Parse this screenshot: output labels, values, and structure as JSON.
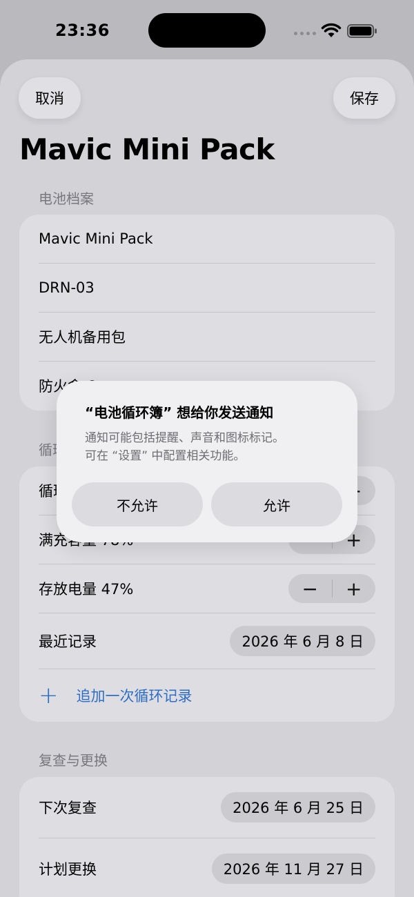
{
  "status_bar": {
    "time": "23:36"
  },
  "nav": {
    "cancel_label": "取消",
    "save_label": "保存",
    "title": "Mavic Mini Pack"
  },
  "profile_section": {
    "header": "电池档案",
    "rows": [
      "Mavic Mini Pack",
      "DRN-03",
      "无人机备用包",
      "防火盒 6"
    ]
  },
  "cycle_section": {
    "header": "循环",
    "rows": {
      "cycles_label": "循环次数",
      "full_charge_label": "满充容量 78%",
      "storage_charge_label": "存放电量 47%",
      "last_record_label": "最近记录",
      "last_record_date": "2026 年 6 月 8 日",
      "add_record_label": "追加一次循环记录"
    },
    "stepper": {
      "minus": "−",
      "plus": "+"
    }
  },
  "review_section": {
    "header": "复查与更换",
    "next_review_label": "下次复查",
    "next_review_date": "2026 年 6 月 25 日",
    "planned_replace_label": "计划更换",
    "planned_replace_date": "2026 年 11 月 27 日"
  },
  "alert": {
    "title": "“电池循环簿” 想给你发送通知",
    "message_line1": "通知可能包括提醒、声音和图标标记。",
    "message_line2": "可在 “设置” 中配置相关功能。",
    "deny_label": "不允许",
    "allow_label": "允许"
  }
}
